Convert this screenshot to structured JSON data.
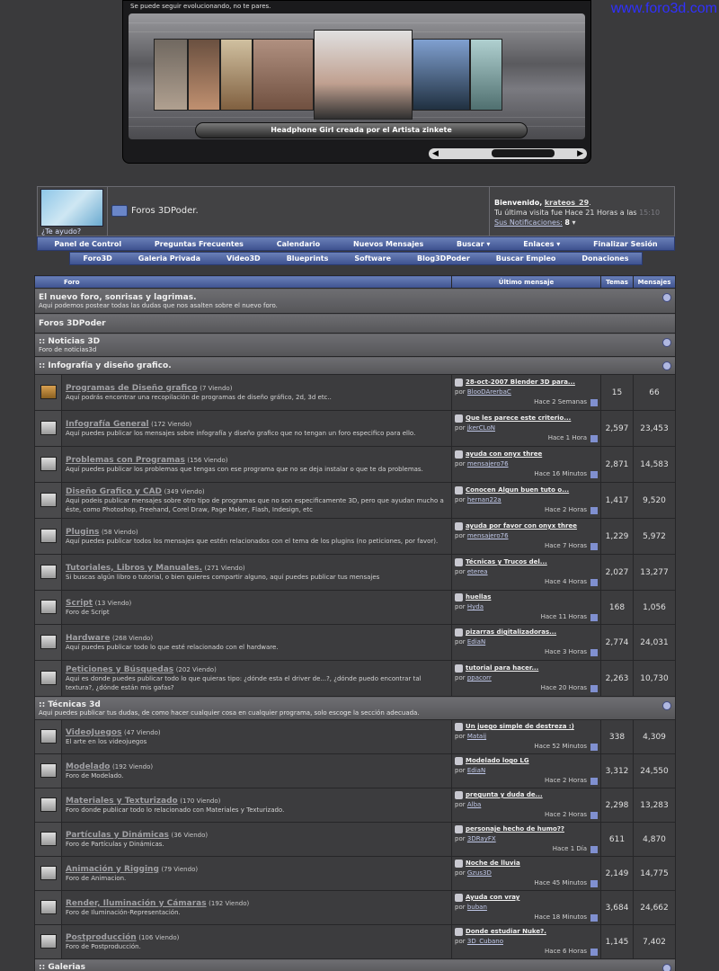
{
  "site_url": "www.foro3d.com",
  "banner": {
    "slogan": "Se puede seguir evolucionando, no te pares.",
    "caption": "Headphone Girl creada por el Artista zinkete"
  },
  "header": {
    "help": "¿Te ayudo?",
    "forum_title": "Foros 3DPoder.",
    "welcome_label": "Bienvenido,",
    "username": "krateos_29",
    "last_visit": "Tu última visita fue Hace 21 Horas a las",
    "last_visit_time": "15:10",
    "notifications_label": "Sus Notificaciones:",
    "notifications_count": "8"
  },
  "menu1": [
    "Panel de Control",
    "Preguntas Frecuentes",
    "Calendario",
    "Nuevos Mensajes",
    "Buscar ▾",
    "Enlaces ▾",
    "Finalizar Sesión"
  ],
  "menu2": [
    "Foro3D",
    "Galeria Privada",
    "Video3D",
    "Blueprints",
    "Software",
    "Blog3DPoder",
    "Buscar Empleo",
    "Donaciones"
  ],
  "table_headers": {
    "forum": "Foro",
    "last": "Último mensaje",
    "threads": "Temas",
    "posts": "Mensajes"
  },
  "sections": {
    "nuevo": {
      "title": "El nuevo foro, sonrisas y lagrimas.",
      "desc": "Aqui podemos postear todas las dudas que nos asalten sobre el nuevo foro."
    },
    "cat": "Foros 3DPoder",
    "noticias": {
      "title": ":: Noticias 3D",
      "desc": "Foro de noticias3d"
    },
    "infografia": {
      "title": ":: Infografía y diseño grafico."
    },
    "tecnicas": {
      "title": ":: Técnicas 3d",
      "desc": "Aqui puedes publicar tus dudas, de como hacer cualquier cosa en cualquier programa, solo escoge la sección adecuada."
    },
    "galerias": {
      "title": ":: Galerias"
    }
  },
  "forums_info": [
    {
      "name": "Programas de Diseño grafico",
      "viewing": "(7 Viendo)",
      "desc": "Aquí podrás encontrar una recopilación de programas de diseño gráfico, 2d, 3d etc..",
      "last_title": "28-oct-2007 Blender 3D para...",
      "by": "por",
      "last_user": "BlooDArerbaC",
      "last_when": "Hace 2 Semanas",
      "threads": "15",
      "posts": "66"
    },
    {
      "name": "Infografía General",
      "viewing": "(172 Viendo)",
      "desc": "Aquí puedes publicar los mensajes sobre infografía y diseño grafico que no tengan un foro especifico para ello.",
      "last_title": "Que les parece este criterio...",
      "by": "por",
      "last_user": "jkerCLoN",
      "last_when": "Hace 1 Hora",
      "threads": "2,597",
      "posts": "23,453"
    },
    {
      "name": "Problemas con Programas",
      "viewing": "(156 Viendo)",
      "desc": "Aquí puedes publicar los problemas que tengas con ese programa que no se deja instalar o que te da problemas.",
      "last_title": "ayuda con onyx three",
      "by": "por",
      "last_user": "mensajero76",
      "last_when": "Hace 16 Minutos",
      "threads": "2,871",
      "posts": "14,583"
    },
    {
      "name": "Diseño Grafico y CAD",
      "viewing": "(349 Viendo)",
      "desc": "Aqui podeis publicar mensajes sobre otro tipo de programas que no son especificamente 3D, pero que ayudan mucho a éste, como Photoshop, Freehand, Corel Draw, Page Maker, Flash, Indesign, etc",
      "last_title": "Conocen Algun buen tuto o...",
      "by": "por",
      "last_user": "hernan22a",
      "last_when": "Hace 2 Horas",
      "threads": "1,417",
      "posts": "9,520"
    },
    {
      "name": "Plugins",
      "viewing": "(58 Viendo)",
      "desc": "Aquí puedes publicar todos los mensajes que estén relacionados con el tema de los plugins (no peticiones, por favor).",
      "last_title": "ayuda por favor con onyx three",
      "by": "por",
      "last_user": "mensajero76",
      "last_when": "Hace 7 Horas",
      "threads": "1,229",
      "posts": "5,972"
    },
    {
      "name": "Tutoriales, Libros y Manuales.",
      "viewing": "(271 Viendo)",
      "desc": "Si buscas algún libro o tutorial, o bien quieres compartir alguno, aquí puedes publicar tus mensajes",
      "last_title": "Técnicas y Trucos del...",
      "by": "por",
      "last_user": "eterea",
      "last_when": "Hace 4 Horas",
      "threads": "2,027",
      "posts": "13,277"
    },
    {
      "name": "Script",
      "viewing": "(13 Viendo)",
      "desc": "Foro de Script",
      "last_title": "huellas",
      "by": "por",
      "last_user": "Hyda",
      "last_when": "Hace 11 Horas",
      "threads": "168",
      "posts": "1,056"
    },
    {
      "name": "Hardware",
      "viewing": "(268 Viendo)",
      "desc": "Aquí puedes publicar todo lo que esté relacionado con el hardware.",
      "last_title": "pizarras digitalizadoras...",
      "by": "por",
      "last_user": "EdiaN",
      "last_when": "Hace 3 Horas",
      "threads": "2,774",
      "posts": "24,031"
    },
    {
      "name": "Peticiones y Búsquedas",
      "viewing": "(202 Viendo)",
      "desc": "Aqui es donde puedes publicar todo lo que quieras tipo: ¿dónde esta el driver de...?, ¿dónde puedo encontrar tal textura?, ¿dónde están mis gafas?",
      "last_title": "tutorial para hacer...",
      "by": "por",
      "last_user": "ppacorr",
      "last_when": "Hace 20 Horas",
      "threads": "2,263",
      "posts": "10,730"
    }
  ],
  "forums_tec": [
    {
      "name": "VideoJuegos",
      "viewing": "(47 Viendo)",
      "desc": "El arte en los videojuegos",
      "last_title": "Un juego simple de destreza :)",
      "by": "por",
      "last_user": "Mataij",
      "last_when": "Hace 52 Minutos",
      "threads": "338",
      "posts": "4,309"
    },
    {
      "name": "Modelado",
      "viewing": "(192 Viendo)",
      "desc": "Foro de Modelado.",
      "last_title": "Modelado logo LG",
      "by": "por",
      "last_user": "EdiaN",
      "last_when": "Hace 2 Horas",
      "threads": "3,312",
      "posts": "24,550"
    },
    {
      "name": "Materiales y Texturizado",
      "viewing": "(170 Viendo)",
      "desc": "Foro donde publicar todo lo relacionado con Materiales y Texturizado.",
      "last_title": "pregunta y duda de...",
      "by": "por",
      "last_user": "Alba",
      "last_when": "Hace 2 Horas",
      "threads": "2,298",
      "posts": "13,283"
    },
    {
      "name": "Partículas y Dinámicas",
      "viewing": "(36 Viendo)",
      "desc": "Foro de Partículas y Dinámicas.",
      "last_title": "personaje hecho de humo??",
      "by": "por",
      "last_user": "3DRayFX",
      "last_when": "Hace 1 Día",
      "threads": "611",
      "posts": "4,870"
    },
    {
      "name": "Animación y Rigging",
      "viewing": "(79 Viendo)",
      "desc": "Foro de Animacion.",
      "last_title": "Noche de lluvia",
      "by": "por",
      "last_user": "Gzus3D",
      "last_when": "Hace 45 Minutos",
      "threads": "2,149",
      "posts": "14,775"
    },
    {
      "name": "Render, Iluminación y Cámaras",
      "viewing": "(192 Viendo)",
      "desc": "Foro de Iluminación-Representación.",
      "last_title": "Ayuda con vray",
      "by": "por",
      "last_user": "buban",
      "last_when": "Hace 18 Minutos",
      "threads": "3,684",
      "posts": "24,662"
    },
    {
      "name": "Postproducción",
      "viewing": "(106 Viendo)",
      "desc": "Foro de Postproducción.",
      "last_title": "Donde estudiar Nuke?.",
      "by": "por",
      "last_user": "3D_Cubano",
      "last_when": "Hace 6 Horas",
      "threads": "1,145",
      "posts": "7,402"
    }
  ]
}
